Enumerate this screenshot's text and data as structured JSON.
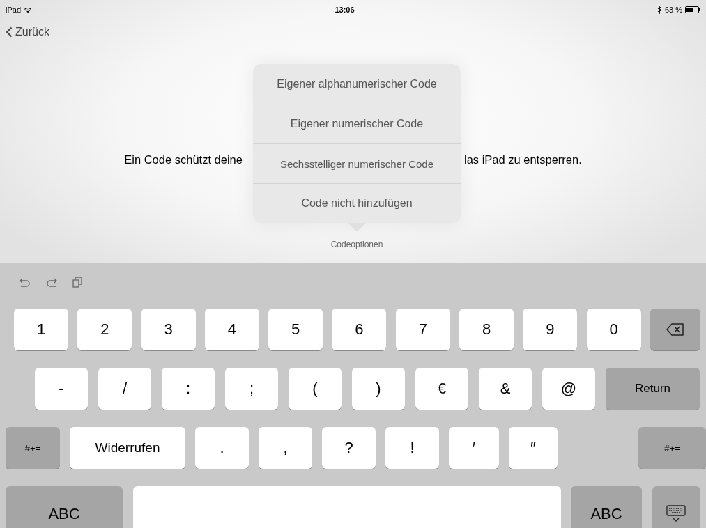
{
  "status_bar": {
    "device": "iPad",
    "time": "13:06",
    "battery": "63 %"
  },
  "back_button": {
    "label": "Zurück"
  },
  "message": {
    "before": "Ein Code schützt deine",
    "after": "las iPad zu entsperren."
  },
  "popover": {
    "items": [
      {
        "label": "Eigener alphanumerischer Code"
      },
      {
        "label": "Eigener numerischer Code"
      },
      {
        "label": "Sechsstelliger numerischer Code"
      },
      {
        "label": "Code nicht hinzufügen"
      }
    ],
    "title": "Codeoptionen"
  },
  "keyboard": {
    "rows": [
      [
        {
          "kind": "char",
          "label": "1"
        },
        {
          "kind": "char",
          "label": "2"
        },
        {
          "kind": "char",
          "label": "3"
        },
        {
          "kind": "char",
          "label": "4"
        },
        {
          "kind": "char",
          "label": "5"
        },
        {
          "kind": "char",
          "label": "6"
        },
        {
          "kind": "char",
          "label": "7"
        },
        {
          "kind": "char",
          "label": "8"
        },
        {
          "kind": "char",
          "label": "9"
        },
        {
          "kind": "char",
          "label": "0"
        },
        {
          "kind": "delete"
        }
      ],
      [
        {
          "kind": "char",
          "label": "-"
        },
        {
          "kind": "char",
          "label": "/"
        },
        {
          "kind": "char",
          "label": ":"
        },
        {
          "kind": "char",
          "label": ";"
        },
        {
          "kind": "char",
          "label": "("
        },
        {
          "kind": "char",
          "label": ")"
        },
        {
          "kind": "char",
          "label": "€"
        },
        {
          "kind": "char",
          "label": "&"
        },
        {
          "kind": "char",
          "label": "@"
        },
        {
          "kind": "action",
          "label": "Return"
        }
      ],
      [
        {
          "kind": "action",
          "label": "#+="
        },
        {
          "kind": "char",
          "label": "Widerrufen"
        },
        {
          "kind": "char",
          "label": "."
        },
        {
          "kind": "char",
          "label": ","
        },
        {
          "kind": "char",
          "label": "?"
        },
        {
          "kind": "char",
          "label": "!"
        },
        {
          "kind": "char",
          "label": "′"
        },
        {
          "kind": "char",
          "label": "″"
        },
        {
          "kind": "action",
          "label": "#+="
        }
      ],
      [
        {
          "kind": "action",
          "label": "ABC"
        },
        {
          "kind": "space"
        },
        {
          "kind": "action",
          "label": "ABC"
        },
        {
          "kind": "dismiss"
        }
      ]
    ]
  }
}
